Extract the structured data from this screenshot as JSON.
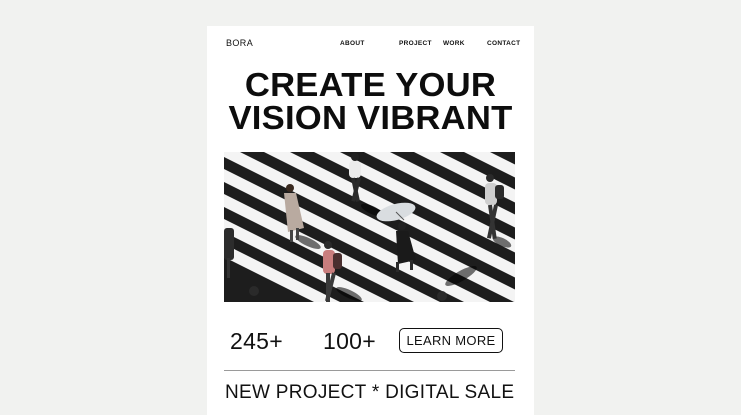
{
  "header": {
    "brand": "BORA",
    "nav": [
      {
        "label": "ABOUT"
      },
      {
        "label": "PROJECT"
      },
      {
        "label": "WORK"
      },
      {
        "label": "CONTACT"
      }
    ]
  },
  "hero": {
    "headline_line1": "CREATE YOUR",
    "headline_line2": "VISION VIBRANT",
    "image_subject": "aerial view of pedestrians on zebra crosswalk"
  },
  "stats": [
    {
      "value": "245+"
    },
    {
      "value": "100+"
    }
  ],
  "cta": {
    "label": "LEARN MORE"
  },
  "ticker": {
    "text": "NEW PROJECT * DIGITAL SALE"
  },
  "colors": {
    "page_bg": "#f1f2f0",
    "card_bg": "#ffffff",
    "text": "#111111",
    "stripe_dark": "#1d1d1d",
    "stripe_light": "#f4f4f4"
  }
}
